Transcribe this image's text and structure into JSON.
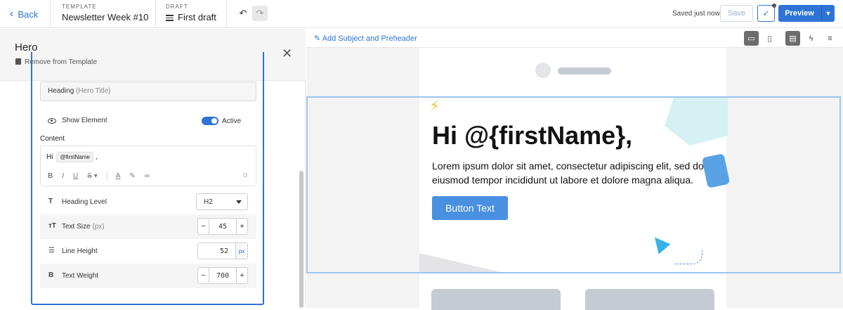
{
  "topbar": {
    "back_label": "Back",
    "template_caption": "TEMPLATE",
    "template_name": "Newsletter Week #10",
    "draft_caption": "DRAFT",
    "draft_name": "First draft",
    "saved_status": "Saved just now",
    "save_label": "Save",
    "preview_label": "Preview"
  },
  "panel": {
    "title": "Hero",
    "remove_label": "Remove from Template",
    "heading_field": "Heading",
    "heading_field_sub": "(Hero Title)",
    "show_element_label": "Show Element",
    "active_label": "Active",
    "content_label": "Content",
    "content_text_prefix": "Hi",
    "content_tag": "@firstName",
    "content_text_suffix": ",",
    "format_icons": [
      "bold-icon",
      "italic-icon",
      "underline-icon",
      "strikethrough-icon",
      "text-color-icon",
      "highlight-icon",
      "link-icon",
      "emoji-icon"
    ],
    "properties": {
      "heading_level": {
        "label": "Heading Level",
        "value": "H2"
      },
      "text_size": {
        "label": "Text Size",
        "unit": "(px)",
        "value": "45"
      },
      "line_height": {
        "label": "Line Height",
        "value": "52",
        "unit": "px"
      },
      "text_weight": {
        "label": "Text Weight",
        "value": "700"
      }
    }
  },
  "canvas": {
    "add_subject_label": "Add Subject and Preheader",
    "hero_heading": "Hi @{firstName},",
    "hero_paragraph": "Lorem ipsum dolor sit amet, consectetur adipiscing elit, sed do eiusmod tempor incididunt ut labore et dolore magna aliqua.",
    "hero_button": "Button Text"
  },
  "colors": {
    "accent": "#2d74d6",
    "hero_button": "#4a90e2",
    "selection_border": "#9cc4f0"
  }
}
